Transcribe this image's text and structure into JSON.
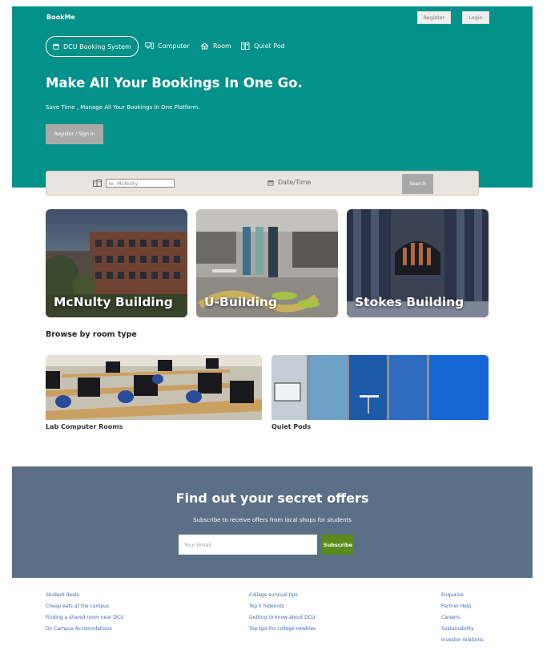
{
  "header": {
    "brand": "BookMe",
    "register_label": "Register",
    "login_label": "Login",
    "nav": [
      {
        "label": "DCU Booking System",
        "icon": "calendar-icon"
      },
      {
        "label": "Computer",
        "icon": "computer-icon"
      },
      {
        "label": "Room",
        "icon": "room-icon"
      },
      {
        "label": "Quiet Pod",
        "icon": "quiet-pod-icon"
      }
    ]
  },
  "hero": {
    "headline": "Make All Your Bookings In One Go.",
    "subline": "Save Time , Manage All Your Bookings In One Platform.",
    "cta_label": "Register / Sign In"
  },
  "search": {
    "location_placeholder": "ie, McNulty",
    "date_label": "Date/Time",
    "button_label": "Search"
  },
  "buildings": [
    {
      "name": "McNulty Building"
    },
    {
      "name": "U-Building"
    },
    {
      "name": "Stokes Building"
    }
  ],
  "room_types": {
    "title": "Browse by room type",
    "items": [
      {
        "label": "Lab Computer Rooms"
      },
      {
        "label": "Quiet Pods"
      }
    ]
  },
  "offers": {
    "title": "Find out your secret offers",
    "subtitle": "Subscribe to receive offers from local shops for students",
    "email_placeholder": "Your Email",
    "button_label": "Subscribe"
  },
  "footer": {
    "col1": [
      "Student deals",
      "Cheap eats at the campus",
      "Finding a shared room near DCU",
      "On Campus Accomodations"
    ],
    "col2": [
      "College survival tips",
      "Top 5 hideouts",
      "Getting to know about DCU",
      "Top tips for college newbies"
    ],
    "col3": [
      "Enquiries",
      "Partner Help",
      "Careers",
      "Sustainability",
      "Investor relations"
    ]
  },
  "colors": {
    "hero_bg": "#04918a",
    "offers_bg": "#5b7086",
    "subscribe": "#5a8a1c",
    "link": "#3a6ab0"
  }
}
